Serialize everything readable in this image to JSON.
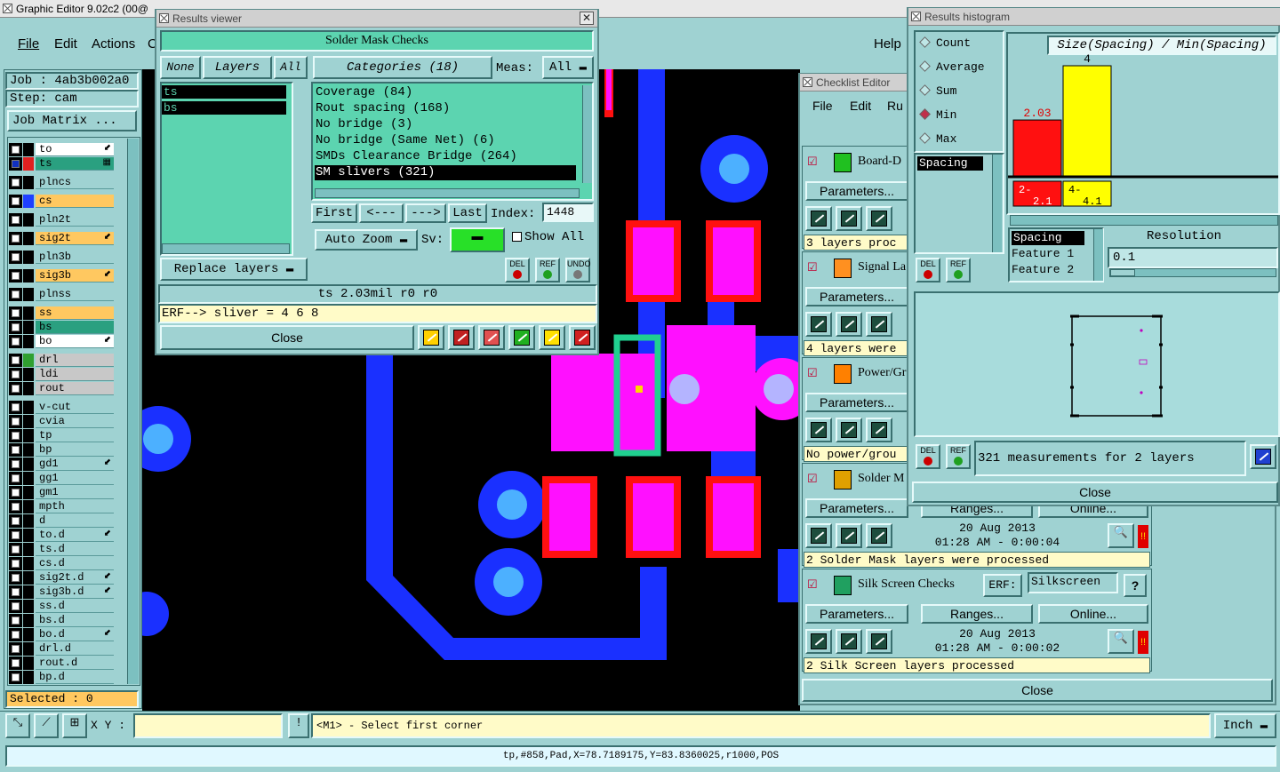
{
  "main": {
    "title": "Graphic Editor 9.02c2 (00@",
    "menu": [
      "File",
      "Edit",
      "Actions",
      "C"
    ],
    "help": "Help",
    "job": "Job : 4ab3b002a0",
    "step": "Step: cam",
    "job_matrix": "Job Matrix ...",
    "selected": "Selected : 0",
    "xy_label": "X Y :",
    "prompt": "<M1> - Select first corner",
    "units": "Inch",
    "status": "tp,#858,Pad,X=78.7189175,Y=83.8360025,r1000,POS"
  },
  "layers": [
    {
      "name": "to",
      "swatch": "#000000",
      "bg": "#ffffff",
      "mark": "⬋"
    },
    {
      "name": "ts",
      "swatch": "#e02020",
      "bg": "#2aa080",
      "mark": "▦",
      "sel": true
    },
    {
      "name": "plncs",
      "swatch": "#000000",
      "bg": "#9fd2d2",
      "mark": ""
    },
    {
      "name": "cs",
      "swatch": "#1e40ff",
      "bg": "#ffc860",
      "mark": ""
    },
    {
      "name": "pln2t",
      "swatch": "#000000",
      "bg": "#9fd2d2",
      "mark": ""
    },
    {
      "name": "sig2t",
      "swatch": "#000000",
      "bg": "#ffc860",
      "mark": "⬋"
    },
    {
      "name": "pln3b",
      "swatch": "#000000",
      "bg": "#9fd2d2",
      "mark": ""
    },
    {
      "name": "sig3b",
      "swatch": "#000000",
      "bg": "#ffc860",
      "mark": "⬋"
    },
    {
      "name": "plnss",
      "swatch": "#000000",
      "bg": "#9fd2d2",
      "mark": ""
    },
    {
      "name": "ss",
      "swatch": "#000000",
      "bg": "#ffc860",
      "mark": ""
    },
    {
      "name": "bs",
      "swatch": "#000000",
      "bg": "#2aa080",
      "mark": ""
    },
    {
      "name": "bo",
      "swatch": "#000000",
      "bg": "#ffffff",
      "mark": "⬋"
    },
    {
      "name": "drl",
      "swatch": "#30a030",
      "bg": "#c8c8c8",
      "mark": ""
    },
    {
      "name": "ldi",
      "swatch": "#000000",
      "bg": "#c8c8c8",
      "mark": ""
    },
    {
      "name": "rout",
      "swatch": "#000000",
      "bg": "#c8c8c8",
      "mark": ""
    },
    {
      "name": "v-cut",
      "swatch": "#000000",
      "bg": "#9fd2d2",
      "mark": ""
    },
    {
      "name": "cvia",
      "swatch": "#000000",
      "bg": "#9fd2d2",
      "mark": ""
    },
    {
      "name": "tp",
      "swatch": "#000000",
      "bg": "#9fd2d2",
      "mark": ""
    },
    {
      "name": "bp",
      "swatch": "#000000",
      "bg": "#9fd2d2",
      "mark": ""
    },
    {
      "name": "gd1",
      "swatch": "#000000",
      "bg": "#9fd2d2",
      "mark": "⬋"
    },
    {
      "name": "gg1",
      "swatch": "#000000",
      "bg": "#9fd2d2",
      "mark": ""
    },
    {
      "name": "gm1",
      "swatch": "#000000",
      "bg": "#9fd2d2",
      "mark": ""
    },
    {
      "name": "mpth",
      "swatch": "#000000",
      "bg": "#9fd2d2",
      "mark": ""
    },
    {
      "name": "d",
      "swatch": "#000000",
      "bg": "#9fd2d2",
      "mark": ""
    },
    {
      "name": "to.d",
      "swatch": "#000000",
      "bg": "#9fd2d2",
      "mark": "⬋"
    },
    {
      "name": "ts.d",
      "swatch": "#000000",
      "bg": "#9fd2d2",
      "mark": ""
    },
    {
      "name": "cs.d",
      "swatch": "#000000",
      "bg": "#9fd2d2",
      "mark": ""
    },
    {
      "name": "sig2t.d",
      "swatch": "#000000",
      "bg": "#9fd2d2",
      "mark": "⬋"
    },
    {
      "name": "sig3b.d",
      "swatch": "#000000",
      "bg": "#9fd2d2",
      "mark": "⬋"
    },
    {
      "name": "ss.d",
      "swatch": "#000000",
      "bg": "#9fd2d2",
      "mark": ""
    },
    {
      "name": "bs.d",
      "swatch": "#000000",
      "bg": "#9fd2d2",
      "mark": ""
    },
    {
      "name": "bo.d",
      "swatch": "#000000",
      "bg": "#9fd2d2",
      "mark": "⬋"
    },
    {
      "name": "drl.d",
      "swatch": "#000000",
      "bg": "#9fd2d2",
      "mark": ""
    },
    {
      "name": "rout.d",
      "swatch": "#000000",
      "bg": "#9fd2d2",
      "mark": ""
    },
    {
      "name": "bp.d",
      "swatch": "#000000",
      "bg": "#9fd2d2",
      "mark": ""
    }
  ],
  "results": {
    "title": "Results viewer",
    "header": "Solder Mask Checks",
    "none": "None",
    "layers": "Layers",
    "all": "All",
    "categories": "Categories (18)",
    "meas": "Meas:",
    "meas_val": "All",
    "layer_list": [
      "ts",
      "bs"
    ],
    "cats": [
      "Coverage (84)",
      "Rout spacing (168)",
      "No bridge (3)",
      "No bridge (Same Net) (6)",
      "SMDs Clearance Bridge (264)",
      "SM slivers (321)"
    ],
    "first": "First",
    "prev": "<---",
    "next": "--->",
    "last": "Last",
    "index_label": "Index:",
    "index": "1448",
    "zoom": "Auto Zoom",
    "sv": "Sv:",
    "show_all": "Show All",
    "replace": "Replace layers",
    "del": "DEL",
    "ref": "REF",
    "undo": "UNDO",
    "info": "ts 2.03mil  r0  r0",
    "erf": "ERF--> sliver = 4 6 8",
    "close": "Close"
  },
  "checklist": {
    "title": "Checklist Editor",
    "menu": [
      "File",
      "Edit",
      "Ru"
    ],
    "params": "Parameters...",
    "ranges": "Ranges...",
    "online": "Online...",
    "close": "Close",
    "erf": "ERF:",
    "erf_val": "Silkscreen",
    "help": "?",
    "items": [
      {
        "name": "Board-D",
        "status": "3 layers proc"
      },
      {
        "name": "Signal La",
        "status": "4 layers were"
      },
      {
        "name": "Power/Gr",
        "status": "No power/grou"
      },
      {
        "name": "Solder M",
        "status": "2 Solder Mask layers were processed",
        "date": "20 Aug 2013",
        "time": "01:28 AM - 0:00:04"
      },
      {
        "name": "Silk Screen Checks",
        "status": "2 Silk Screen layers processed",
        "date": "20 Aug 2013",
        "time": "01:28 AM - 0:00:02"
      }
    ]
  },
  "histogram": {
    "title": "Results histogram",
    "options": [
      "Count",
      "Average",
      "Sum",
      "Min",
      "Max"
    ],
    "selected": "Min",
    "list": [
      "Spacing"
    ],
    "formula": "Size(Spacing) / Min(Spacing)",
    "del": "DEL",
    "ref": "REF",
    "fields": [
      "Spacing",
      "Feature 1",
      "Feature 2"
    ],
    "resolution_label": "Resolution",
    "resolution": "0.1",
    "summary": "321 measurements for 2 layers",
    "close": "Close",
    "bins": [
      {
        "label": "2-",
        "label2": "2.1",
        "value": 2.03,
        "display": "2.03",
        "color": "#ff1010"
      },
      {
        "label": "4-",
        "label2": "4.1",
        "value": 4,
        "display": "4",
        "color": "#ffff00"
      }
    ]
  }
}
